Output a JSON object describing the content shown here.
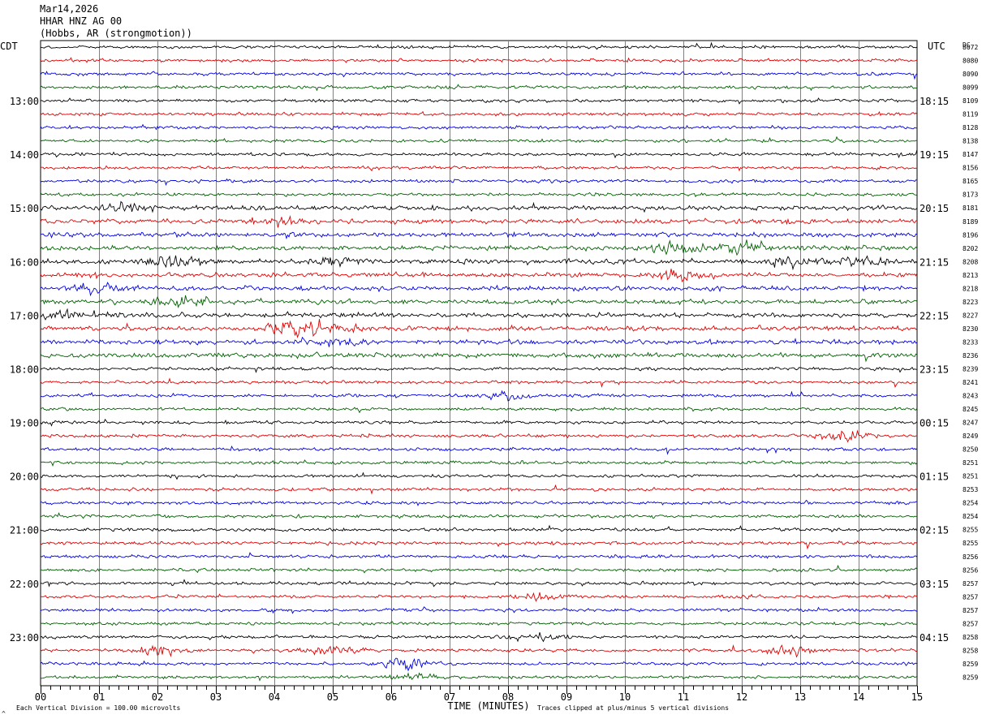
{
  "header": {
    "date": "Mar14,2026",
    "station": "HHAR HNZ AG 00",
    "location": "(Hobbs, AR (strongmotion))"
  },
  "chart_data": {
    "type": "line",
    "title": "",
    "left_timezone": "CDT",
    "right_timezone": "UTC",
    "dc_label": "DC",
    "xlabel": "TIME (MINUTES)",
    "xlim": [
      0,
      15
    ],
    "x_ticks": [
      "00",
      "01",
      "02",
      "03",
      "04",
      "05",
      "06",
      "07",
      "08",
      "09",
      "10",
      "11",
      "12",
      "13",
      "14",
      "15"
    ],
    "trace_colors": [
      "#000000",
      "#e00000",
      "#0000e0",
      "#006000"
    ],
    "hour_labels_left": [
      "13:00",
      "14:00",
      "15:00",
      "16:00",
      "17:00",
      "18:00",
      "19:00",
      "20:00",
      "21:00",
      "22:00",
      "23:00"
    ],
    "hour_labels_right": [
      "18:15",
      "19:15",
      "20:15",
      "21:15",
      "22:15",
      "23:15",
      "00:15",
      "01:15",
      "02:15",
      "03:15",
      "04:15"
    ],
    "first_hour_label_row": 4,
    "dc_offsets": [
      "8072",
      "8080",
      "8090",
      "8099",
      "8109",
      "8119",
      "8128",
      "8138",
      "8147",
      "8156",
      "8165",
      "8173",
      "8181",
      "8189",
      "8196",
      "8202",
      "8208",
      "8213",
      "8218",
      "8223",
      "8227",
      "8230",
      "8233",
      "8236",
      "8239",
      "8241",
      "8243",
      "8245",
      "8247",
      "8249",
      "8250",
      "8251",
      "8251",
      "8253",
      "8254",
      "8254",
      "8255",
      "8255",
      "8256",
      "8256",
      "8257",
      "8257",
      "8257",
      "8257",
      "8258",
      "8258",
      "8259",
      "8259"
    ],
    "scale_note": "Each Vertical Division =  100.00 microvolts",
    "clip_note": "Traces clipped at plus/minus 5 vertical divisions",
    "corner_mark": "^"
  }
}
